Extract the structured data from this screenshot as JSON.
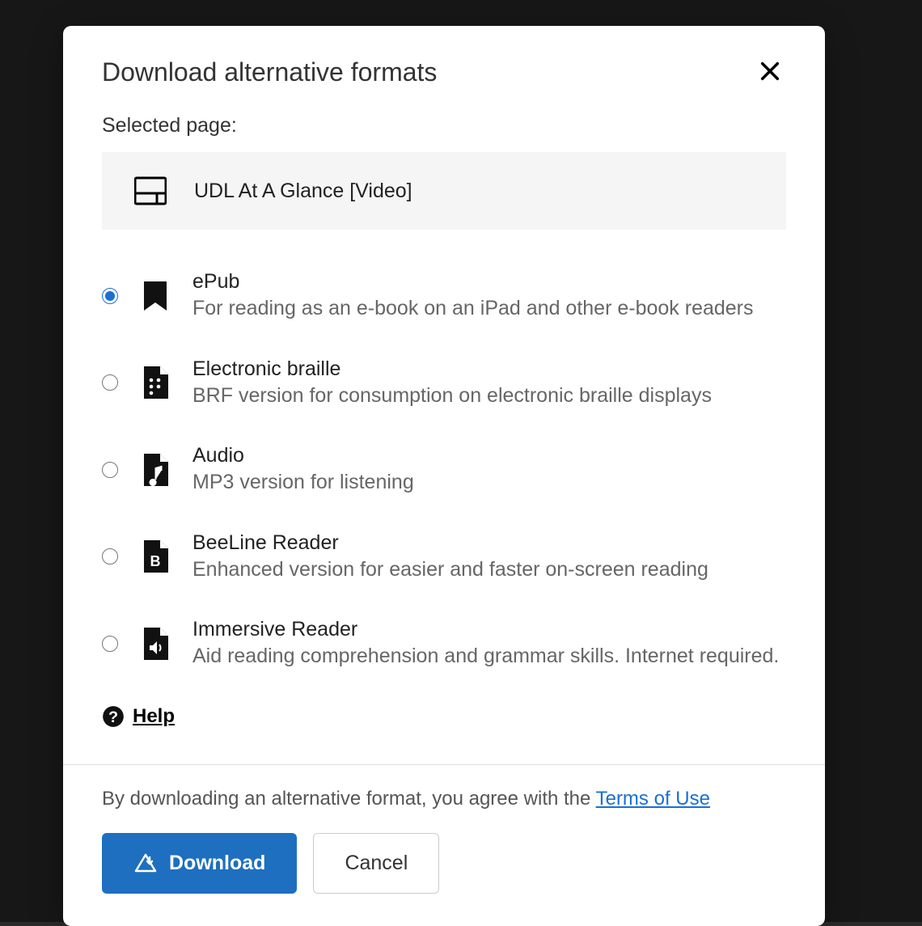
{
  "modal": {
    "title": "Download alternative formats",
    "selected_label": "Selected page:",
    "page_name": "UDL At A Glance [Video]"
  },
  "options": [
    {
      "id": "epub",
      "title": "ePub",
      "desc": "For reading as an e-book on an iPad and other e-book readers",
      "selected": true,
      "icon": "bookmark-icon"
    },
    {
      "id": "braille",
      "title": "Electronic braille",
      "desc": "BRF version for consumption on electronic braille displays",
      "selected": false,
      "icon": "braille-file-icon"
    },
    {
      "id": "audio",
      "title": "Audio",
      "desc": "MP3 version for listening",
      "selected": false,
      "icon": "audio-file-icon"
    },
    {
      "id": "beeline",
      "title": "BeeLine Reader",
      "desc": "Enhanced version for easier and faster on-screen reading",
      "selected": false,
      "icon": "beeline-file-icon"
    },
    {
      "id": "immersive",
      "title": "Immersive Reader",
      "desc": "Aid reading comprehension and grammar skills. Internet required.",
      "selected": false,
      "icon": "immersive-file-icon"
    }
  ],
  "help_label": "Help",
  "footer": {
    "terms_prefix": "By downloading an alternative format, you agree with the ",
    "terms_link": "Terms of Use",
    "download_label": "Download",
    "cancel_label": "Cancel"
  }
}
